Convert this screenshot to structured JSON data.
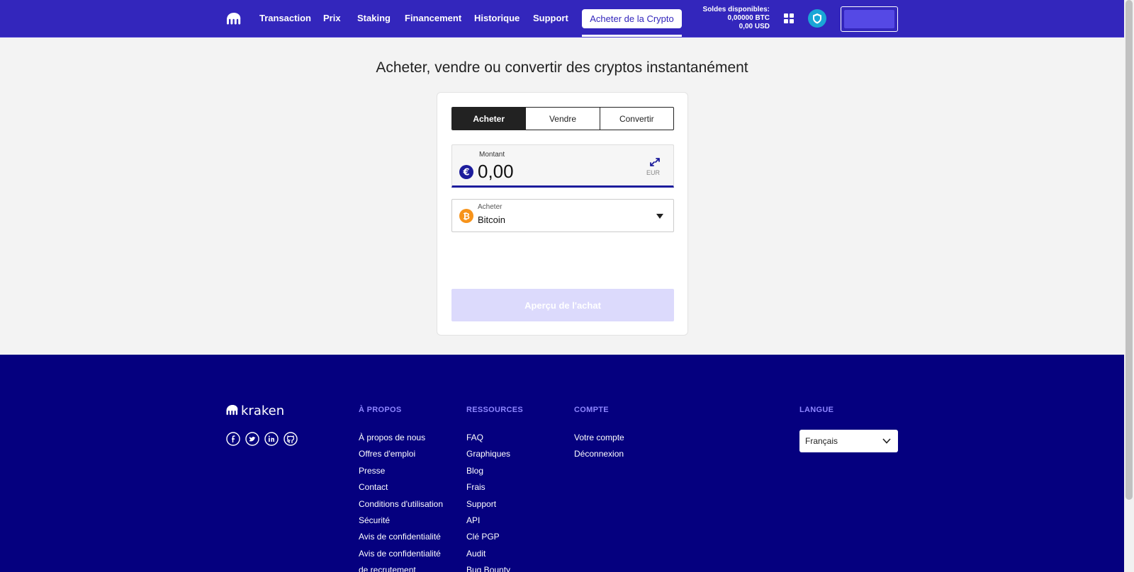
{
  "header": {
    "nav": [
      "Transaction",
      "Prix",
      "Staking",
      "Financement",
      "Historique",
      "Support"
    ],
    "buy_crypto": "Acheter de la Crypto",
    "balance_title": "Soldes disponibles:",
    "balance_btc": "0,00000 BTC",
    "balance_usd": "0,00 USD"
  },
  "main": {
    "title": "Acheter, vendre ou convertir des cryptos instantanément",
    "tabs": [
      "Acheter",
      "Vendre",
      "Convertir"
    ],
    "amount_label": "Montant",
    "amount_value": "0,00",
    "currency": "EUR",
    "asset_label": "Acheter",
    "asset_value": "Bitcoin",
    "preview_button": "Aperçu de l'achat"
  },
  "footer": {
    "about_heading": "À PROPOS",
    "about_links": [
      "À propos de nous",
      "Offres d'emploi",
      "Presse",
      "Contact",
      "Conditions d'utilisation",
      "Sécurité",
      "Avis de confidentialité",
      "Avis de confidentialité",
      "de recrutement"
    ],
    "resources_heading": "RESSOURCES",
    "resources_links": [
      "FAQ",
      "Graphiques",
      "Blog",
      "Frais",
      "Support",
      "API",
      "Clé PGP",
      "Audit",
      "Bug Bounty"
    ],
    "account_heading": "COMPTE",
    "account_links": [
      "Votre compte",
      "Déconnexion"
    ],
    "language_heading": "LANGUE",
    "language_value": "Français"
  },
  "colors": {
    "header_bg": "#3326bc",
    "footer_bg": "#05007f",
    "footer_heading": "#8e86ff",
    "preview_disabled": "#dcdafc",
    "btc_orange": "#f7931a",
    "shield_teal": "#1aa6d6"
  },
  "icons": [
    "kraken-logo-icon",
    "apps-grid-icon",
    "shield-icon",
    "euro-icon",
    "swap-icon",
    "bitcoin-icon",
    "caret-down-icon",
    "facebook-icon",
    "twitter-icon",
    "linkedin-icon",
    "github-icon",
    "chevron-down-icon"
  ]
}
